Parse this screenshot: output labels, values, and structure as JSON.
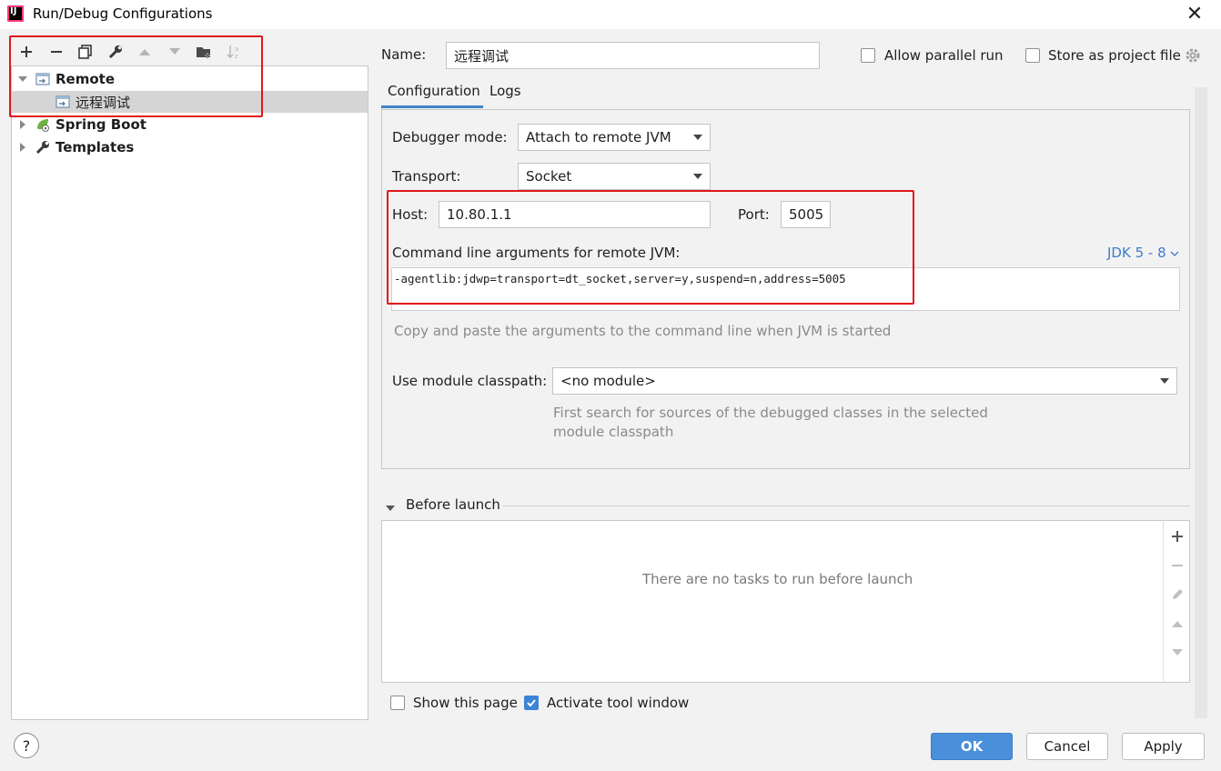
{
  "window": {
    "title": "Run/Debug Configurations",
    "close_icon": "close-icon"
  },
  "toolbar": {
    "items": [
      {
        "icon": "add-icon",
        "glyph": "+"
      },
      {
        "icon": "remove-icon",
        "glyph": "−"
      },
      {
        "icon": "copy-icon",
        "glyph": "⧉"
      },
      {
        "icon": "wrench-icon",
        "glyph": "🔧"
      },
      {
        "icon": "move-up-icon",
        "glyph": "▲"
      },
      {
        "icon": "move-down-icon",
        "glyph": "▼"
      },
      {
        "icon": "folder-add-icon",
        "glyph": "📁"
      },
      {
        "icon": "sort-icon",
        "glyph": "⇅"
      }
    ]
  },
  "tree": {
    "remote": "Remote",
    "remote_child": "远程调试",
    "spring_boot": "Spring Boot",
    "templates": "Templates"
  },
  "form": {
    "name_label": "Name:",
    "name_value": "远程调试",
    "allow_parallel": "Allow parallel run",
    "store_project": "Store as project file",
    "tab_configuration": "Configuration",
    "tab_logs": "Logs",
    "debugger_mode_label": "Debugger mode:",
    "debugger_mode_value": "Attach to remote JVM",
    "transport_label": "Transport:",
    "transport_value": "Socket",
    "host_label": "Host:",
    "host_value": "10.80.1.1",
    "port_label": "Port:",
    "port_value": "5005",
    "cmd_label": "Command line arguments for remote JVM:",
    "jdk_link": "JDK 5 - 8",
    "cmd_value": "-agentlib:jdwp=transport=dt_socket,server=y,suspend=n,address=5005",
    "cmd_hint": "Copy and paste the arguments to the command line when JVM is started",
    "module_label": "Use module classpath:",
    "module_value": "<no module>",
    "module_hint_1": "First search for sources of the debugged classes in the selected",
    "module_hint_2": "module classpath"
  },
  "before_launch": {
    "title": "Before launch",
    "empty": "There are no tasks to run before launch",
    "show_page": "Show this page",
    "activate_tool": "Activate tool window"
  },
  "buttons": {
    "ok": "OK",
    "cancel": "Cancel",
    "apply": "Apply",
    "help": "?"
  }
}
